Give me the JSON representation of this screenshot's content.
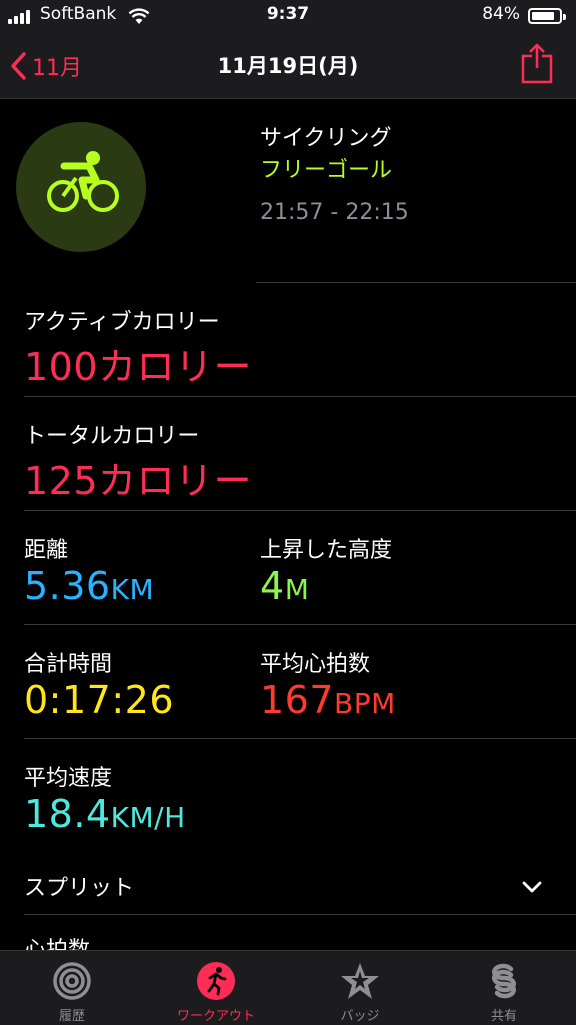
{
  "status_bar": {
    "carrier": "SoftBank",
    "time": "9:37",
    "battery": "84%",
    "battery_level": 0.84
  },
  "nav": {
    "back_label": "11月",
    "title": "11月19日(月)"
  },
  "workout": {
    "type": "サイクリング",
    "goal": "フリーゴール",
    "time_range": "21:57 - 22:15"
  },
  "metrics": {
    "active_calories": {
      "label": "アクティブカロリー",
      "value": "100カロリー"
    },
    "total_calories": {
      "label": "トータルカロリー",
      "value": "125カロリー"
    },
    "distance": {
      "label": "距離",
      "value": "5.36",
      "unit": "KM"
    },
    "elevation": {
      "label": "上昇した高度",
      "value": "4",
      "unit": "M"
    },
    "total_time": {
      "label": "合計時間",
      "value": "0:17:26"
    },
    "avg_heart_rate": {
      "label": "平均心拍数",
      "value": "167",
      "unit": "BPM"
    },
    "avg_speed": {
      "label": "平均速度",
      "value": "18.4",
      "unit": "KM/H"
    }
  },
  "sections": {
    "splits": "スプリット",
    "heart_rate": "心拍数"
  },
  "tabs": [
    {
      "label": "履歴",
      "icon": "rings-icon"
    },
    {
      "label": "ワークアウト",
      "icon": "runner-icon"
    },
    {
      "label": "バッジ",
      "icon": "star-badge-icon"
    },
    {
      "label": "共有",
      "icon": "sharing-icon"
    }
  ],
  "colors": {
    "accent": "#ff2d55",
    "goal": "#b6ff1e",
    "distance": "#29b3ff",
    "elevation": "#8cf54e",
    "time": "#ffe619",
    "heart_rate": "#ff3b30",
    "speed": "#4de8e0"
  }
}
